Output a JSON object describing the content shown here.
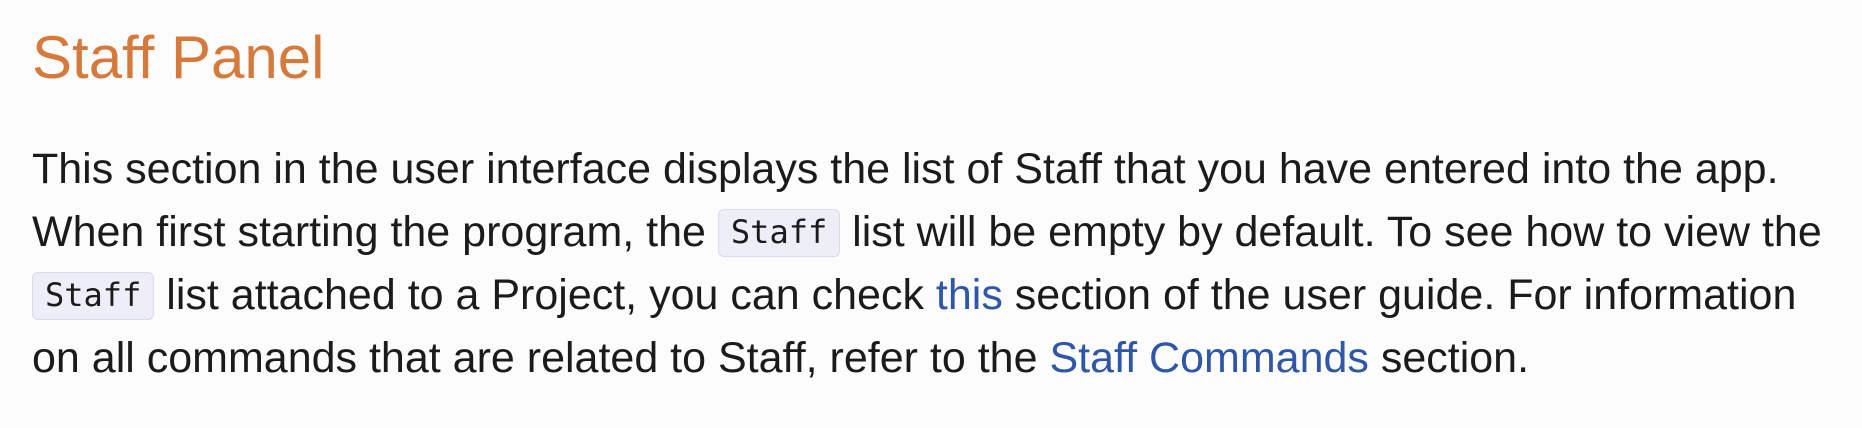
{
  "heading": "Staff Panel",
  "paragraph": {
    "t1": "This section in the user interface displays the list of Staff that you have entered into the app.",
    "t2": " When first starting the program, the ",
    "code1": "Staff",
    "t3": " list will be empty by default. To see how to view the ",
    "code2": "Staff",
    "t4": " list attached to a Project, you can check ",
    "link1": "this",
    "t5": " section of the user guide. For information on all commands that are related to Staff, refer to the ",
    "link2": "Staff Commands",
    "t6": " section."
  },
  "colors": {
    "heading": "#d57a3b",
    "link": "#2f57a8",
    "text": "#1b1b1b",
    "code_background": "#eeeef8"
  }
}
